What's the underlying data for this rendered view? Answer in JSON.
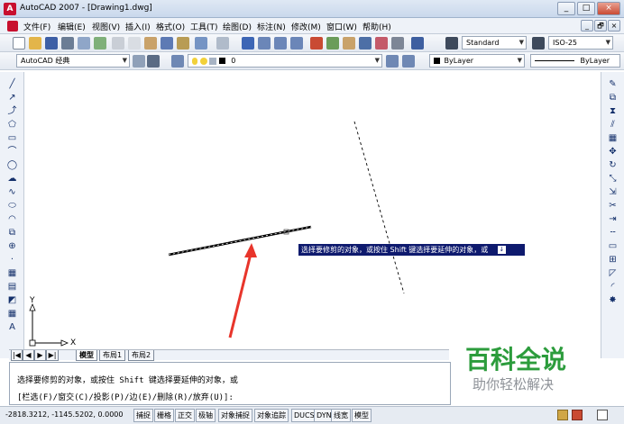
{
  "window": {
    "title": "AutoCAD 2007 - [Drawing1.dwg]",
    "app_icon": "A",
    "buttons": [
      "_",
      "□",
      "×"
    ],
    "doc_buttons": [
      "_",
      "🗗",
      "×"
    ]
  },
  "menubar": {
    "items": [
      "文件(F)",
      "编辑(E)",
      "视图(V)",
      "插入(I)",
      "格式(O)",
      "工具(T)",
      "绘图(D)",
      "标注(N)",
      "修改(M)",
      "窗口(W)",
      "帮助(H)"
    ]
  },
  "toolbar1": {
    "text_style": "Standard",
    "dim_style": "ISO-25"
  },
  "toolbar2": {
    "workspace": "AutoCAD 经典",
    "layer": "0",
    "color": "ByLayer",
    "linetype": "ByLayer"
  },
  "canvas": {
    "ucs_x": "X",
    "ucs_y": "Y",
    "tooltip": "选择要修剪的对象，或按住 Shift 键选择要延伸的对象，或",
    "tooltip_icon": "↓"
  },
  "tabs": {
    "nav": [
      "|◀",
      "◀",
      "▶",
      "▶|"
    ],
    "items": [
      "模型",
      "布局1",
      "布局2"
    ]
  },
  "command": {
    "line1": "选择要修剪的对象，或按住 Shift 键选择要延伸的对象，或",
    "line2": "[栏选(F)/窗交(C)/投影(P)/边(E)/删除(R)/放弃(U)]:"
  },
  "status": {
    "coords": "-2818.3212, -1145.5202, 0.0000",
    "buttons": [
      "捕捉",
      "栅格",
      "正交",
      "极轴",
      "对象捕捉",
      "对象追踪",
      "DUCS",
      "DYN",
      "线宽",
      "模型"
    ]
  },
  "watermark": {
    "title": "百科全说",
    "subtitle": "助你轻松解决"
  },
  "colors": {
    "tooltip_bg": "#0e1a6e",
    "arrow": "#e8352b",
    "watermark_green": "#2c9c3c"
  }
}
